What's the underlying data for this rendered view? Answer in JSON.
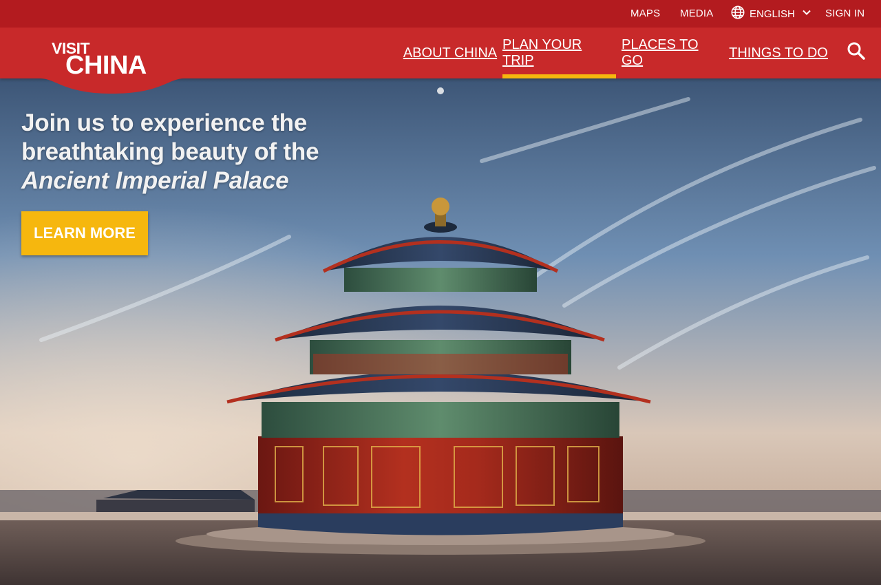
{
  "topbar": {
    "maps": "MAPS",
    "media": "MEDIA",
    "language": "ENGLISH",
    "sign_in": "SIGN IN"
  },
  "logo": {
    "line1": "VISIT",
    "line2": "CHINA"
  },
  "nav": {
    "items": [
      {
        "label": "ABOUT CHINA",
        "active": false
      },
      {
        "label": "PLAN YOUR TRIP",
        "active": true
      },
      {
        "label": "PLACES TO GO",
        "active": false
      },
      {
        "label": "THINGS TO DO",
        "active": false
      }
    ]
  },
  "hero": {
    "headline_line1": "Join us to experience the",
    "headline_line2": "breathtaking beauty of the",
    "headline_emphasis": "Ancient Imperial Palace",
    "cta_label": "LEARN MORE"
  },
  "icons": {
    "language": "globe-icon",
    "dropdown": "chevron-down-icon",
    "search": "search-icon"
  },
  "colors": {
    "topbar": "#b31b1f",
    "nav": "#c8292a",
    "accent": "#f6b70e",
    "text": "#ffffff"
  }
}
